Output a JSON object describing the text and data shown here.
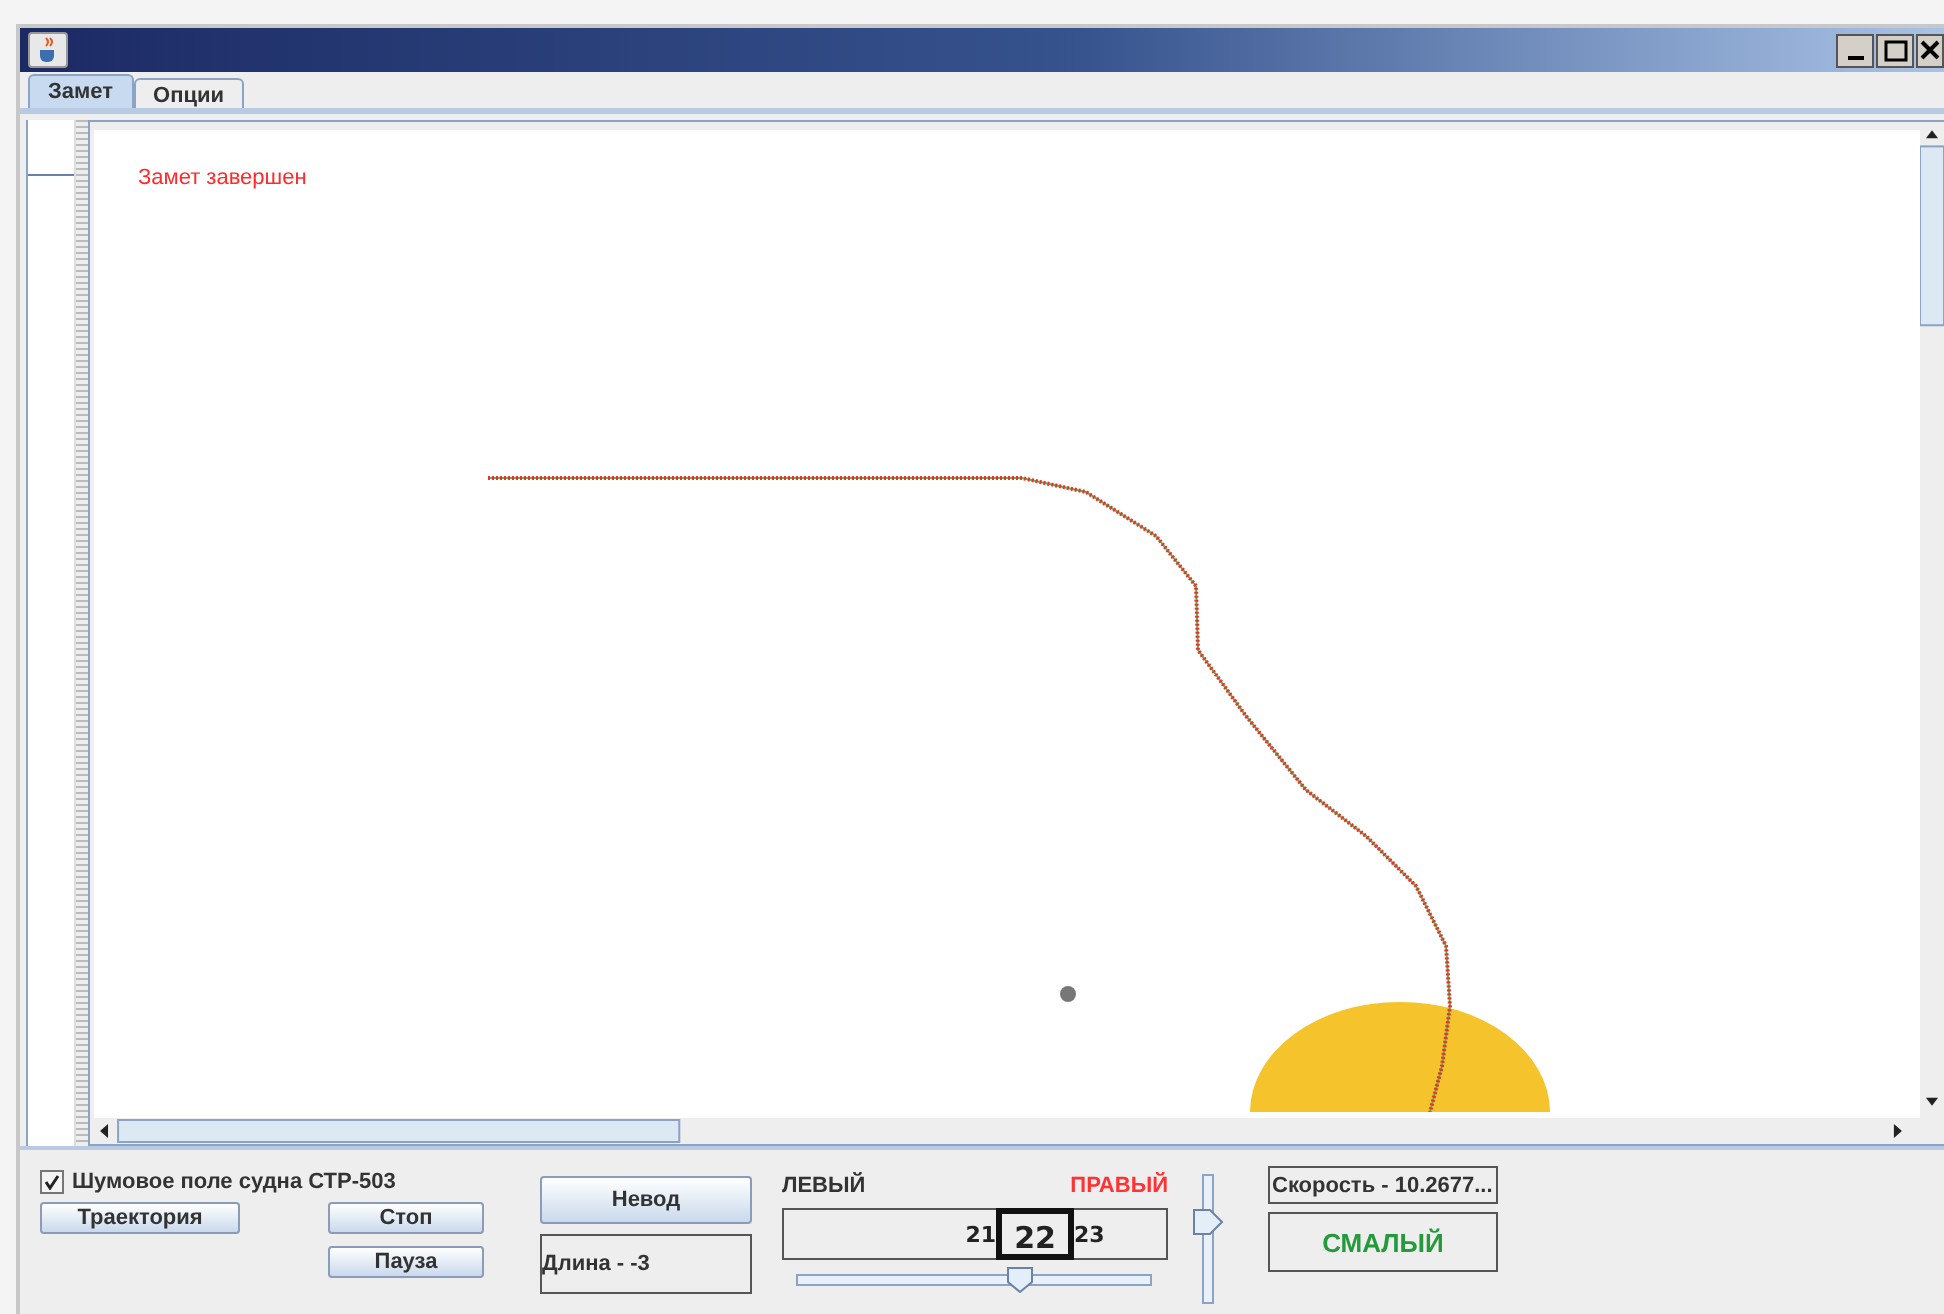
{
  "tabs": [
    {
      "label": "Замет",
      "selected": true
    },
    {
      "label": "Опции",
      "selected": false
    }
  ],
  "canvas": {
    "status": "Замет завершен"
  },
  "controls": {
    "noise_field": {
      "label": "Шумовое поле судна СТР-503",
      "checked": true
    },
    "buttons": [
      {
        "label": "Траектория"
      },
      {
        "label": "Стоп"
      },
      {
        "label": "Пауза"
      },
      {
        "label": "Невод"
      }
    ],
    "length": "Длина - -3",
    "sides": [
      {
        "label": "ЛЕВЫЙ",
        "selected": false
      },
      {
        "label": "ПРАВЫЙ",
        "selected": true
      }
    ],
    "spinner": [
      {
        "value": "21",
        "selected": false
      },
      {
        "value": "22",
        "selected": true
      },
      {
        "value": "23",
        "selected": false
      }
    ],
    "horizontal_slider": {
      "level": 0.63
    },
    "vertical_slider": {
      "level": 0.63
    },
    "speed": "Скорость - 10.2677...",
    "mode": "СМАЛЫЙ"
  }
}
